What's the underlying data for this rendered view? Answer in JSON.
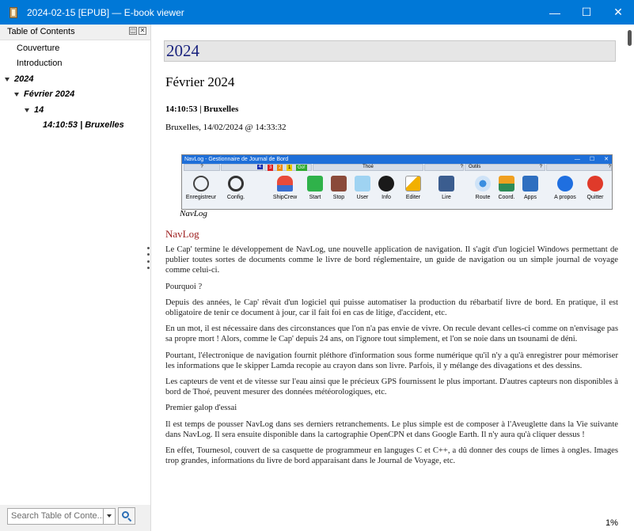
{
  "window": {
    "title": "2024-02-15 [EPUB] — E-book viewer",
    "controls": {
      "minimize": "—",
      "maximize": "☐",
      "close": "✕"
    }
  },
  "sidebar": {
    "header": "Table of Contents",
    "header_buttons": [
      "◫",
      "✕"
    ],
    "toc": [
      {
        "label": "Couverture",
        "level": 0,
        "expanded": false,
        "style": "normal"
      },
      {
        "label": "Introduction",
        "level": 0,
        "expanded": false,
        "style": "normal"
      },
      {
        "label": "2024",
        "level": 0,
        "expanded": true,
        "style": "bold-italic"
      },
      {
        "label": "Février 2024",
        "level": 1,
        "expanded": true,
        "style": "bold-italic"
      },
      {
        "label": "14",
        "level": 2,
        "expanded": true,
        "style": "bold-italic"
      },
      {
        "label": "14:10:53 | Bruxelles",
        "level": 3,
        "expanded": false,
        "style": "bold-italic"
      }
    ],
    "search": {
      "placeholder": "Search Table of Conte...",
      "icon": "search-icon"
    }
  },
  "content": {
    "h1": "2024",
    "h2": "Février 2024",
    "h3": "14:10:53 | Bruxelles",
    "location": "Bruxelles, 14/02/2024 @ 14:33:32",
    "image": {
      "title": "NavLog - Gestionnaire de Journal de Bord",
      "window_controls": [
        "—",
        "☐",
        "✕"
      ],
      "groups": [
        "?",
        "4",
        "3",
        "2",
        "1",
        "Go!",
        "Thoé",
        "?",
        "Outils",
        "?",
        "?"
      ],
      "buttons": [
        "Enregistreur",
        "Config.",
        "ShipCrew",
        "Start",
        "Stop",
        "User",
        "Info",
        "Editer",
        "Lire",
        "Route",
        "Coord.",
        "Apps",
        "A propos",
        "Quitter"
      ],
      "caption": "NavLog"
    },
    "section_title": "NavLog",
    "paragraphs": [
      "Le Cap' termine le développement de NavLog, une nouvelle application de navigation. Il s'agit d'un logiciel Windows permettant de publier toutes sortes de documents comme le livre de bord réglementaire, un guide de navigation ou un simple journal de voyage comme celui-ci.",
      "Pourquoi ?",
      "Depuis des années, le Cap' rêvait d'un logiciel qui puisse automatiser la production du rébarbatif livre de bord. En pratique, il est obligatoire de tenir ce document à jour, car il fait foi en cas de litige, d'accident, etc.",
      "En un mot, il est nécessaire dans des circonstances que l'on n'a pas envie de vivre. On recule devant celles-ci comme on n'envisage pas sa propre mort ! Alors, comme le Cap' depuis 24 ans, on l'ignore tout simplement, et l'on se noie dans un tsounami de déni.",
      "Pourtant, l'électronique de navigation fournit pléthore d'information sous forme numérique qu'il n'y a qu'à enregistrer pour mémoriser les informations que le skipper Lamda recopie au crayon dans son livre. Parfois, il y mélange des divagations et des dessins.",
      "Les capteurs de vent et de vitesse sur l'eau ainsi que le précieux GPS fournissent le plus important. D'autres capteurs non disponibles à bord de Thoé, peuvent mesurer des données météorologiques, etc.",
      "Premier galop d'essai",
      "Il est temps de pousser NavLog dans ses derniers retranchements. Le plus simple est de composer à l'Aveuglette dans la Vie suivante dans NavLog. Il sera ensuite disponible dans la cartographie OpenCPN et dans Google Earth. Il n'y aura qu'à cliquer dessus !",
      "En effet, Tournesol, couvert de sa casquette de programmeur en languges C et C++, a dû donner des coups de limes à ongles. Images trop grandes, informations du livre de bord apparaisant dans le Journal de Voyage, etc."
    ],
    "progress_percent": "1%"
  }
}
